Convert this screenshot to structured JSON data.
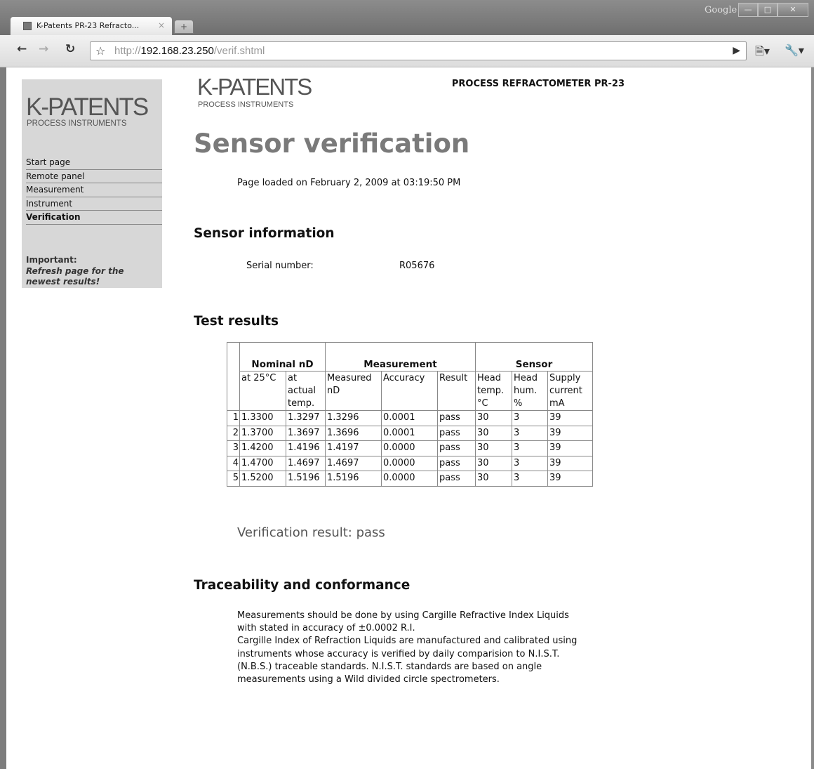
{
  "browser": {
    "tab_title": "K-Patents PR-23 Refracto...",
    "tab_close": "×",
    "new_tab": "+",
    "top_label": "Google",
    "url_prefix": "http://",
    "url_host": "192.168.23.250",
    "url_path": "/verif.shtml"
  },
  "sidebar": {
    "logo": "K-PATENTS",
    "logo_sub": "PROCESS INSTRUMENTS",
    "nav": [
      {
        "label": "Start page"
      },
      {
        "label": "Remote panel"
      },
      {
        "label": "Measurement"
      },
      {
        "label": "Instrument"
      },
      {
        "label": "Verification",
        "active": true
      }
    ],
    "important_label": "Important:",
    "important_note_1": "Refresh page for the",
    "important_note_2": "newest results!"
  },
  "header": {
    "logo": "K-PATENTS",
    "logo_sub": "PROCESS INSTRUMENTS",
    "product": "PROCESS REFRACTOMETER PR-23"
  },
  "page": {
    "title": "Sensor verification",
    "loaded": "Page loaded on February 2, 2009 at 03:19:50 PM"
  },
  "sensor_info": {
    "heading": "Sensor information",
    "serial_label": "Serial number:",
    "serial_value": "R05676"
  },
  "test_results": {
    "heading": "Test results",
    "groups": [
      "Nominal nD",
      "Measurement",
      "Sensor"
    ],
    "subheaders": [
      "at 25°C",
      "at actual temp.",
      "Measured nD",
      "Accuracy",
      "Result",
      "Head temp. °C",
      "Head hum. %",
      "Supply current mA"
    ],
    "rows": [
      {
        "n": "1",
        "nominal": "1.3300",
        "actual": "1.3297",
        "measured": "1.3296",
        "accuracy": "0.0001",
        "result": "pass",
        "temp": "30",
        "hum": "3",
        "current": "39"
      },
      {
        "n": "2",
        "nominal": "1.3700",
        "actual": "1.3697",
        "measured": "1.3696",
        "accuracy": "0.0001",
        "result": "pass",
        "temp": "30",
        "hum": "3",
        "current": "39"
      },
      {
        "n": "3",
        "nominal": "1.4200",
        "actual": "1.4196",
        "measured": "1.4197",
        "accuracy": "0.0000",
        "result": "pass",
        "temp": "30",
        "hum": "3",
        "current": "39"
      },
      {
        "n": "4",
        "nominal": "1.4700",
        "actual": "1.4697",
        "measured": "1.4697",
        "accuracy": "0.0000",
        "result": "pass",
        "temp": "30",
        "hum": "3",
        "current": "39"
      },
      {
        "n": "5",
        "nominal": "1.5200",
        "actual": "1.5196",
        "measured": "1.5196",
        "accuracy": "0.0000",
        "result": "pass",
        "temp": "30",
        "hum": "3",
        "current": "39"
      }
    ]
  },
  "verdict": "Verification result: pass",
  "traceability": {
    "heading": "Traceability and conformance",
    "para1": "Measurements should be done by using Cargille Refractive Index Liquids with stated in accuracy of ±0.0002 R.I.",
    "para2": "Cargille Index of Refraction Liquids are manufactured and calibrated using instruments whose accuracy is verified by daily comparision to N.I.S.T. (N.B.S.) traceable standards. N.I.S.T. standards are based on angle measurements using a Wild divided circle spectrometers."
  }
}
